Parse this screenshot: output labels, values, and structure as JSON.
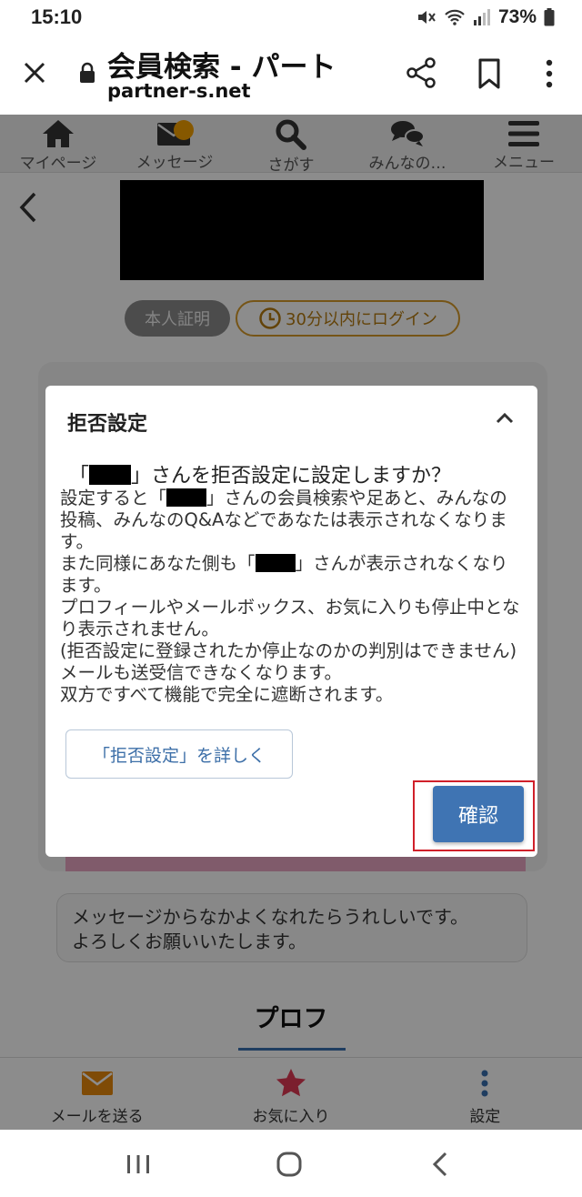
{
  "status_bar": {
    "time": "15:10",
    "battery": "73%",
    "icons": [
      "mute-icon",
      "wifi-icon",
      "signal-icon",
      "battery-icon"
    ]
  },
  "browser": {
    "title": "会員検索 - パート",
    "url": "partner-s.net",
    "icons": [
      "close-icon",
      "lock-icon",
      "share-icon",
      "bookmark-icon",
      "more-icon"
    ]
  },
  "site_nav": {
    "items": [
      {
        "label": "マイページ",
        "icon": "home-icon"
      },
      {
        "label": "メッセージ",
        "icon": "mail-icon"
      },
      {
        "label": "さがす",
        "icon": "search-icon"
      },
      {
        "label": "みんなの…",
        "icon": "chat-icon"
      },
      {
        "label": "メニュー",
        "icon": "hamburger-icon"
      }
    ],
    "message_dot_color": "#f5a000"
  },
  "profile": {
    "badge_verified": "本人証明",
    "badge_login": "30分以内にログイン",
    "intro_line1": "メッセージからなかよくなれたらうれしいです。",
    "intro_line2": "よろしくお願いいたします。",
    "tab_label": "プロフ"
  },
  "bottom_actions": {
    "send_mail": "メールを送る",
    "favorite": "お気に入り",
    "settings": "設定"
  },
  "dialog": {
    "title": "拒否設定",
    "question_open": "「",
    "question_rest": "」さんを拒否設定に設定しますか？",
    "p1_a": "設定すると「",
    "p1_b": "」さんの会員検索や足あと、みんなの投稿、みんなのQ&Aなどであなたは表示されなくなります。",
    "p2_a": "また同様にあなた側も「",
    "p2_b": "」さんが表示されなくなります。",
    "p3": "プロフィールやメールボックス、お気に入りも停止中となり表示されません。",
    "p4": "(拒否設定に登録されたか停止なのかの判別はできません)",
    "p5": "メールも送受信できなくなります。",
    "p6": "双方ですべて機能で完全に遮断されます。",
    "detail_button": "「拒否設定」を詳しく",
    "confirm_button": "確認",
    "accent_color": "#3f74b3",
    "highlight_color": "#d0202a"
  },
  "android_nav": {
    "icons": [
      "recents-icon",
      "home-circle-icon",
      "back-icon"
    ]
  }
}
